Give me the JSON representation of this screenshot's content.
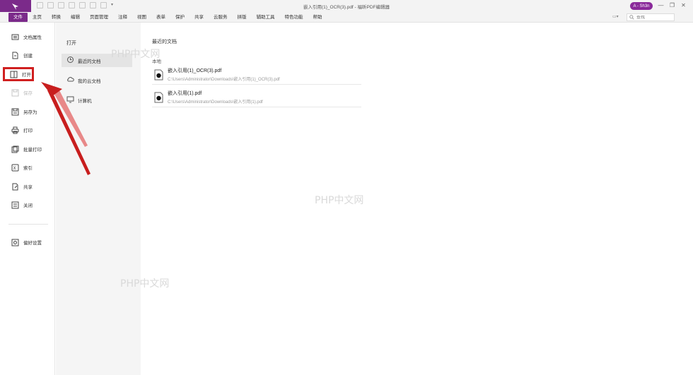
{
  "titlebar": {
    "window_title": "嵌入引用(1)_OCR(3).pdf - 福昕PDF编辑器",
    "qa_dropdown": "▾",
    "user_badge": "A - Sh3n",
    "controls": [
      "—",
      "❐",
      "✕"
    ]
  },
  "menubar": {
    "items": [
      "文件",
      "主页",
      "转换",
      "编辑",
      "页面管理",
      "注释",
      "视图",
      "表单",
      "保护",
      "共享",
      "云服务",
      "拼版",
      "辅助工具",
      "特色功能",
      "帮助"
    ],
    "active_index": 0,
    "view_toggle": "▭▾",
    "search_placeholder": "查找"
  },
  "leftnav": {
    "items": [
      {
        "label": "文档属性",
        "icon": "document-properties-icon"
      },
      {
        "label": "创建",
        "icon": "create-icon"
      },
      {
        "label": "打开",
        "icon": "open-icon"
      },
      {
        "label": "保存",
        "icon": "save-icon"
      },
      {
        "label": "另存为",
        "icon": "save-as-icon"
      },
      {
        "label": "打印",
        "icon": "print-icon"
      },
      {
        "label": "批量打印",
        "icon": "batch-print-icon"
      },
      {
        "label": "索引",
        "icon": "index-icon"
      },
      {
        "label": "共享",
        "icon": "share-icon"
      },
      {
        "label": "关闭",
        "icon": "close-document-icon"
      },
      {
        "label": "偏好设置",
        "icon": "preferences-icon"
      }
    ],
    "selected_index": 2,
    "disabled_index": 3
  },
  "midnav": {
    "title": "打开",
    "items": [
      {
        "label": "最近的文档",
        "icon": "clock-icon"
      },
      {
        "label": "我的云文档",
        "icon": "cloud-icon"
      },
      {
        "label": "计算机",
        "icon": "computer-icon"
      }
    ],
    "selected_index": 0
  },
  "content": {
    "title": "最近的文档",
    "subtitle": "本地",
    "files": [
      {
        "name": "嵌入引用(1)_OCR(3).pdf",
        "path": "C:\\Users\\Administrator\\Downloads\\嵌入引用(1)_OCR(3).pdf"
      },
      {
        "name": "嵌入引用(1).pdf",
        "path": "C:\\Users\\Administrator\\Downloads\\嵌入引用(1).pdf"
      }
    ]
  },
  "watermarks": [
    "PHP中文网",
    "PHP中文网",
    "PHP中文网"
  ],
  "colors": {
    "accent": "#7b2a8a",
    "annotation": "#d02020"
  }
}
